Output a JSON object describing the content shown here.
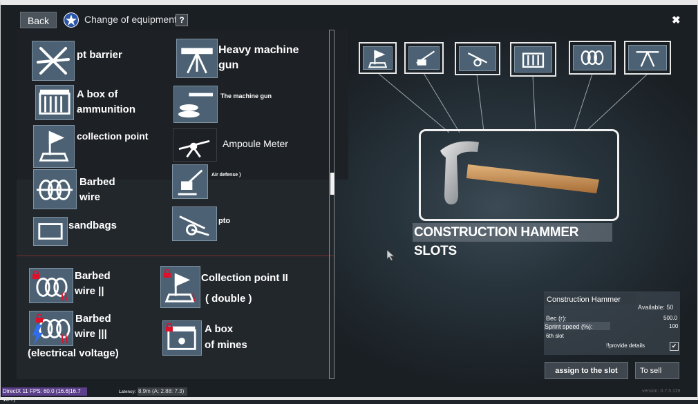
{
  "header": {
    "back_label": "Back",
    "title": "Change of equipment",
    "help_label": "?",
    "close_label": "✖"
  },
  "items": [
    {
      "label": "pt barrier",
      "icon": "tank-barrier-icon"
    },
    {
      "label": "Heavy machine gun",
      "icon": "heavy-machine-gun-icon"
    },
    {
      "label": "A box of ammunition",
      "icon": "ammo-box-icon"
    },
    {
      "label": "The machine gun",
      "icon": "machine-gun-sandbag-icon"
    },
    {
      "label": "collection point",
      "icon": "flag-icon"
    },
    {
      "label": "Ampoule Meter",
      "icon": "ampoule-launcher-icon"
    },
    {
      "label": "Barbed wire",
      "icon": "barbed-wire-icon"
    },
    {
      "label": "Air defense )",
      "icon": "aa-gun-icon"
    },
    {
      "label": "sandbags",
      "icon": "sandbags-icon"
    },
    {
      "label": "pto",
      "icon": "at-gun-icon"
    }
  ],
  "locked_items": [
    {
      "label1": "Barbed",
      "label2": "wire ||",
      "icon": "barbed-wire-icon"
    },
    {
      "label1": "Collection point II",
      "label2": "( double )",
      "icon": "flag-icon"
    },
    {
      "label1": "Barbed",
      "label2": "wire |||",
      "label3": "(electrical voltage)",
      "icon": "electric-barbed-wire-icon"
    },
    {
      "label1": "A box",
      "label2": "of mines",
      "icon": "mine-box-icon"
    }
  ],
  "slots": [
    "flag-icon",
    "at-gun-icon",
    "at-gun-icon",
    "ammo-box-icon",
    "barbed-wire-icon",
    "heavy-machine-gun-icon"
  ],
  "selected_title": "CONSTRUCTION HAMMER SLOTS",
  "info": {
    "name": "Construction Hammer",
    "available": "Available: 50",
    "weight_label": "Вес (г):",
    "weight_value": "500.0",
    "speed_label": "Sprint speed (%):",
    "speed_value": "100",
    "slot": "6th slot",
    "details": "!!provide details",
    "details_checked": "✔"
  },
  "buttons": {
    "assign": "assign to the slot",
    "sell": "To sell"
  },
  "debug": {
    "fps": "DirectX 11 FPS: 60.0 (16.6|16.7 16.7)",
    "latency_label": "Latency:",
    "latency": "8.9m (A: 2.88: 7.3)",
    "version": "version: 0.7.5.119"
  },
  "colors": {
    "tile": "#4c6274",
    "lock": "#e0102a",
    "accent_border": "#f0f0f0"
  }
}
